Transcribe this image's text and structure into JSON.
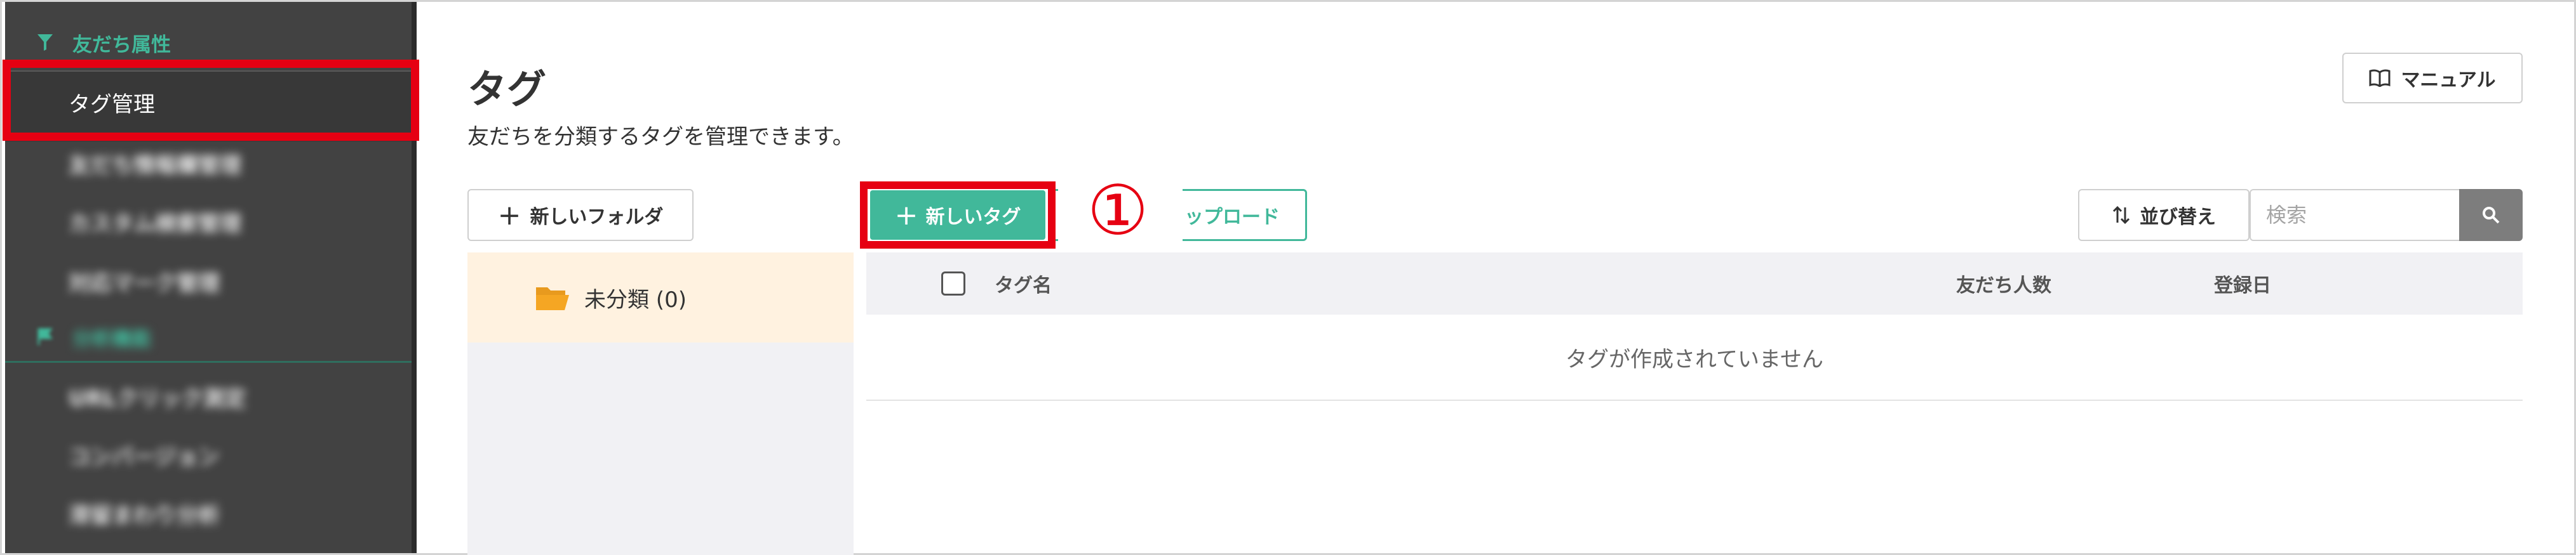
{
  "sidebar": {
    "section_friend_attr": "友だち属性",
    "active_item": "タグ管理",
    "items": [
      {
        "label": "友だち情報欄管理"
      },
      {
        "label": "カスタム検索管理"
      },
      {
        "label": "対応マーク管理"
      }
    ],
    "section_analysis": "分析機能",
    "analysis_items": [
      {
        "label": "URLクリック測定"
      },
      {
        "label": "コンバージョン"
      },
      {
        "label": "滞留まわり分析"
      }
    ],
    "section_icon": "filter-icon",
    "analysis_icon": "flag-icon"
  },
  "header": {
    "title": "タグ",
    "description": "友だちを分類するタグを管理できます。",
    "manual_label": "マニュアル"
  },
  "toolbar": {
    "new_folder_label": "新しいフォルダ",
    "new_tag_label": "新しいタグ",
    "upload_label": "ップロード",
    "sort_label": "並び替え",
    "search_placeholder": "検索"
  },
  "annotation": {
    "step": "①",
    "color": "#e60012"
  },
  "folders": [
    {
      "name": "未分類 (0)"
    }
  ],
  "table": {
    "columns": [
      "タグ名",
      "友だち人数",
      "登録日"
    ],
    "empty_message": "タグが作成されていません"
  },
  "colors": {
    "accent": "#41b89a",
    "sidebar_bg": "#424242",
    "highlight_red": "#e60012",
    "folder_selected_bg": "#fff2e0"
  }
}
